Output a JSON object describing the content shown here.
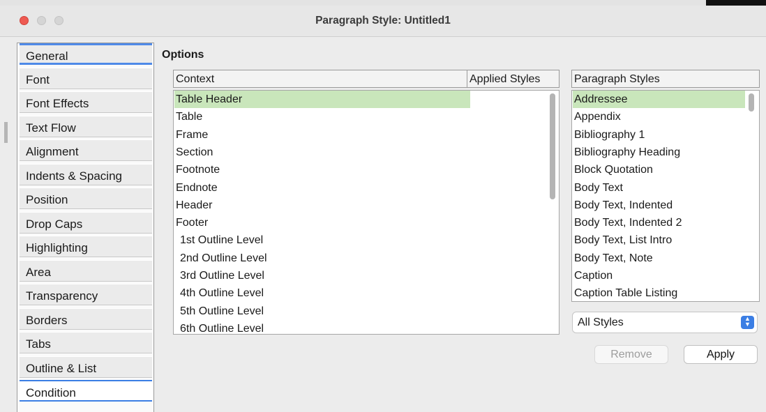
{
  "window": {
    "title": "Paragraph Style: Untitled1"
  },
  "sidebar": {
    "tabs": [
      "General",
      "Font",
      "Font Effects",
      "Text Flow",
      "Alignment",
      "Indents & Spacing",
      "Position",
      "Drop Caps",
      "Highlighting",
      "Area",
      "Transparency",
      "Borders",
      "Tabs",
      "Outline & List",
      "Condition"
    ],
    "selected": "Condition"
  },
  "options": {
    "title": "Options",
    "context_header": "Context",
    "applied_header": "Applied Styles",
    "contexts": [
      "Table Header",
      "Table",
      "Frame",
      "Section",
      "Footnote",
      "Endnote",
      "Header",
      "Footer",
      "1st Outline Level",
      "2nd Outline Level",
      "3rd Outline Level",
      "4th Outline Level",
      "5th Outline Level",
      "6th Outline Level"
    ],
    "selected_context": "Table Header",
    "styles_header": "Paragraph Styles",
    "styles": [
      "Addressee",
      "Appendix",
      "Bibliography 1",
      "Bibliography Heading",
      "Block Quotation",
      "Body Text",
      "Body Text, Indented",
      "Body Text, Indented 2",
      "Body Text, List Intro",
      "Body Text, Note",
      "Caption",
      "Caption Table Listing"
    ],
    "selected_style": "Addressee",
    "filter": "All Styles",
    "remove_label": "Remove",
    "apply_label": "Apply"
  },
  "colors": {
    "selection": "#c9e6bb",
    "accent": "#3b7ee4",
    "close": "#ee5a52"
  },
  "icons": {
    "close": "close-icon",
    "dropdown": "chevron-updown-icon"
  }
}
